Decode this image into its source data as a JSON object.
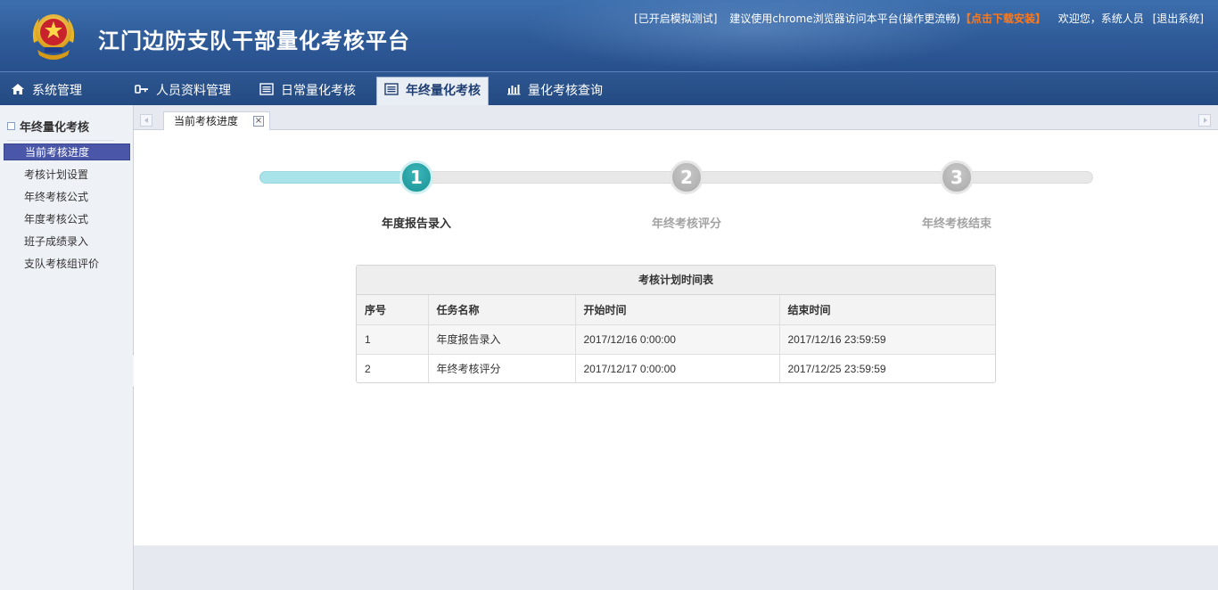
{
  "header": {
    "title": "江门边防支队干部量化考核平台",
    "emblem_icon": "police-emblem-icon",
    "mock_test": "[已开启模拟测试]",
    "browser_tip": "建议使用chrome浏览器访问本平台(操作更流畅)",
    "download": "【点击下载安装】",
    "welcome": "欢迎您，系统人员",
    "logout": "[退出系统]"
  },
  "nav": {
    "items": [
      {
        "label": "系统管理",
        "icon": "home-icon"
      },
      {
        "label": "人员资料管理",
        "icon": "key-icon"
      },
      {
        "label": "日常量化考核",
        "icon": "list-icon"
      },
      {
        "label": "年终量化考核",
        "icon": "list-icon"
      },
      {
        "label": "量化考核查询",
        "icon": "bar-chart-icon"
      }
    ],
    "active_index": 3
  },
  "sidebar": {
    "title": "年终量化考核",
    "items": [
      {
        "label": "当前考核进度"
      },
      {
        "label": "考核计划设置"
      },
      {
        "label": "年终考核公式"
      },
      {
        "label": "年度考核公式"
      },
      {
        "label": "班子成绩录入"
      },
      {
        "label": "支队考核组评价"
      }
    ],
    "active_index": 0
  },
  "tabs": [
    {
      "label": "当前考核进度",
      "close": "×"
    }
  ],
  "steps": {
    "progress_fraction": 0.17,
    "items": [
      {
        "number": "1",
        "label": "年度报告录入",
        "state": "done"
      },
      {
        "number": "2",
        "label": "年终考核评分",
        "state": "todo"
      },
      {
        "number": "3",
        "label": "年终考核结束",
        "state": "todo"
      }
    ]
  },
  "schedule": {
    "title": "考核计划时间表",
    "headers": [
      "序号",
      "任务名称",
      "开始时间",
      "结束时间"
    ],
    "rows": [
      [
        "1",
        "年度报告录入",
        "2017/12/16 0:00:00",
        "2017/12/16 23:59:59"
      ],
      [
        "2",
        "年终考核评分",
        "2017/12/17 0:00:00",
        "2017/12/25 23:59:59"
      ]
    ]
  },
  "colors": {
    "header_blue": "#2f5b98",
    "active_side": "#4a57a8",
    "step_done": "#1a9396",
    "download_orange": "#ff7a1a"
  }
}
